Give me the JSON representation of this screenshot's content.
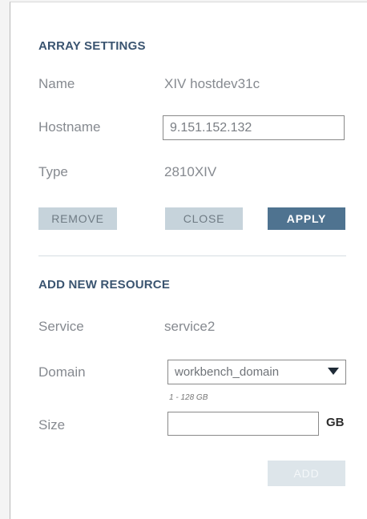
{
  "array_settings": {
    "title": "ARRAY SETTINGS",
    "name_label": "Name",
    "name_value": "XIV hostdev31c",
    "hostname_label": "Hostname",
    "hostname_value": "9.151.152.132",
    "type_label": "Type",
    "type_value": "2810XIV",
    "remove_label": "REMOVE",
    "close_label": "CLOSE",
    "apply_label": "APPLY"
  },
  "add_resource": {
    "title": "ADD NEW RESOURCE",
    "service_label": "Service",
    "service_value": "service2",
    "domain_label": "Domain",
    "domain_value": "workbench_domain",
    "size_hint": "1 - 128 GB",
    "size_label": "Size",
    "size_value": "",
    "size_unit": "GB",
    "add_label": "ADD"
  },
  "colors": {
    "title": "#3a5470",
    "primary_button": "#4f7390",
    "secondary_button": "#c6d3db",
    "disabled_button": "#dde5ea"
  }
}
